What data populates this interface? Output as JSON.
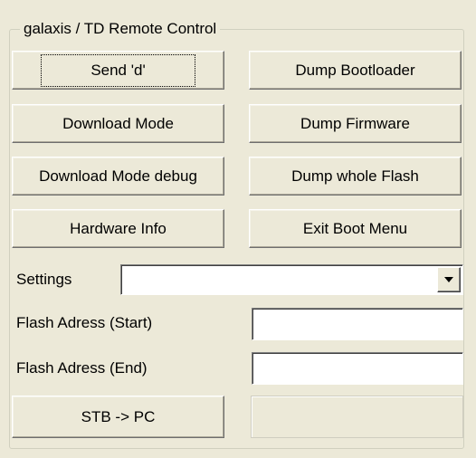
{
  "panel": {
    "title": "galaxis / TD Remote Control"
  },
  "buttons": {
    "send_d": "Send 'd'",
    "dump_bootloader": "Dump Bootloader",
    "download_mode": "Download Mode",
    "dump_firmware": "Dump Firmware",
    "download_mode_debug": "Download Mode debug",
    "dump_whole_flash": "Dump whole Flash",
    "hardware_info": "Hardware Info",
    "exit_boot_menu": "Exit Boot Menu",
    "stb_to_pc": "STB -> PC"
  },
  "settings": {
    "label": "Settings",
    "selected_value": ""
  },
  "flash": {
    "start_label": "Flash Adress (Start)",
    "start_value": "",
    "end_label": "Flash Adress (End)",
    "end_value": ""
  },
  "icons": {
    "dropdown": "chevron-down-icon"
  }
}
